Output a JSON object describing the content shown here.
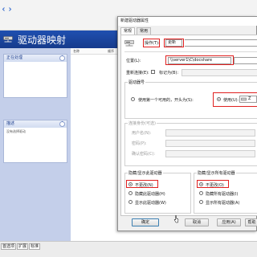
{
  "mmc": {
    "banner_title": "驱动器映射",
    "list_columns": [
      "名称",
      "顺序"
    ],
    "task_boxes": [
      {
        "title": "正在处理",
        "text": ""
      },
      {
        "title": "描述",
        "text": "没有选择驱动"
      }
    ],
    "status_tabs": [
      "首选项",
      "扩展",
      "标准"
    ]
  },
  "dialog": {
    "title": "新建驱动器属性",
    "tabs": [
      "常规",
      "常用"
    ],
    "action_label": "操作(T):",
    "action_value": "更新",
    "location_label": "位置(L):",
    "location_value": "\\\\server1\\C\\docshare",
    "reconnect_label": "重新连接(E):",
    "label_as_label": "标记为(B):",
    "drive_letter_group": "驱动器号",
    "use_first_available": "使用第一个可用的，开头为(S):",
    "use_label": "使用(U):",
    "drive_letter_value": "Z",
    "connect_as_group": "连接身份(可选)",
    "user_name_label": "用户名(N):",
    "password_label": "密码(P):",
    "confirm_password_label": "确认密码(C):",
    "hide_show_this_group": "隐藏/显示此驱动器",
    "hide_show_all_group": "隐藏/显示所有驱动器",
    "this_drive_options": [
      "不更改(N)",
      "隐藏此驱动器(H)",
      "显示此驱动器(W)"
    ],
    "all_drives_options": [
      "不更改(O)",
      "隐藏所有驱动器(I)",
      "显示所有驱动器(A)"
    ],
    "buttons": {
      "ok": "确定",
      "cancel": "取消",
      "apply": "应用(A)",
      "help": "帮助"
    }
  },
  "colors": {
    "highlight_red": "#e0201f",
    "banner_blue": "#1f4fb0"
  }
}
